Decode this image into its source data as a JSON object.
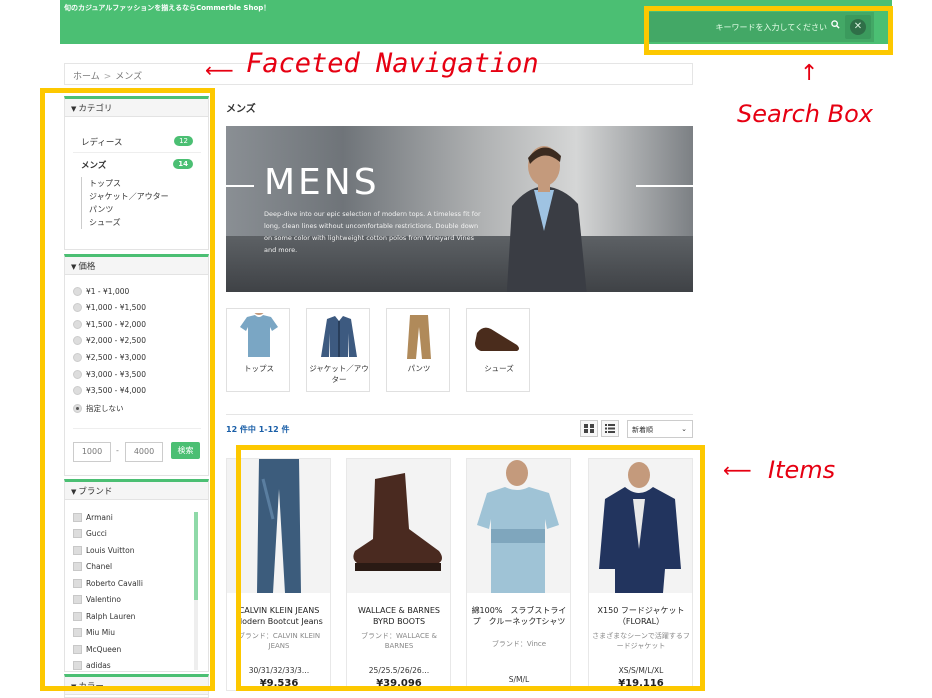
{
  "header": {
    "tagline": "旬のカジュアルファッションを揃えるならCommerble Shop！",
    "search_placeholder": "キーワードを入力してください"
  },
  "annotations": {
    "faceted_navigation": "Faceted Navigation",
    "search_box": "Search Box",
    "items": "Items"
  },
  "breadcrumb": [
    "ホーム",
    "メンズ"
  ],
  "sidebar": {
    "category": {
      "title": "カテゴリ",
      "items": [
        {
          "label": "レディース",
          "count": "12"
        },
        {
          "label": "メンズ",
          "count": "14"
        }
      ],
      "subitems": [
        "トップス",
        "ジャケット／アウター",
        "パンツ",
        "シューズ"
      ]
    },
    "price": {
      "title": "価格",
      "options": [
        "¥1 - ¥1,000",
        "¥1,000 - ¥1,500",
        "¥1,500 - ¥2,000",
        "¥2,000 - ¥2,500",
        "¥2,500 - ¥3,000",
        "¥3,000 - ¥3,500",
        "¥3,500 - ¥4,000",
        "指定しない"
      ],
      "selected_index": 7,
      "min": "1000",
      "max": "4000",
      "dash": "-",
      "search_label": "検索"
    },
    "brand": {
      "title": "ブランド",
      "options": [
        "Armani",
        "Gucci",
        "Louis Vuitton",
        "Chanel",
        "Roberto Cavalli",
        "Valentino",
        "Ralph Lauren",
        "Miu Miu",
        "McQueen",
        "adidas"
      ]
    },
    "color": {
      "title": "カラー"
    }
  },
  "main": {
    "title": "メンズ",
    "hero": {
      "title": "MENS",
      "description": "Deep-dive into our epic selection of modern tops. A timeless fit for long, clean lines without uncomfortable restrictions. Double down on some color with lightweight cotton polos from Vineyard Vines and more."
    },
    "category_tiles": [
      "トップス",
      "ジャケット／アウター",
      "パンツ",
      "シューズ"
    ],
    "result_count": "12 件中 1-12 件",
    "sort": "新着順",
    "products": [
      {
        "name": "CALVIN KLEIN JEANS Modern Bootcut Jeans",
        "brand": "ブランド：CALVIN KLEIN JEANS",
        "sizes": "30/31/32/33/3…",
        "price": "¥9,536"
      },
      {
        "name": "WALLACE & BARNES BYRD BOOTS",
        "brand": "ブランド：WALLACE & BARNES",
        "sizes": "25/25.5/26/26…",
        "price": "¥39,096"
      },
      {
        "name": "綿100%　スラブストライプ　クルーネックTシャツ",
        "brand": "ブランド：Vince",
        "sizes": "S/M/L",
        "price": ""
      },
      {
        "name": "X150 フードジャケット（FLORAL）",
        "brand": "さまざまなシーンで活躍するフードジャケット",
        "sizes": "XS/S/M/L/XL",
        "price": "¥19,116"
      }
    ]
  },
  "colors": {
    "accent": "#4bbf73",
    "annotation_frame": "#fdc800",
    "annotation_text": "#e60012"
  }
}
